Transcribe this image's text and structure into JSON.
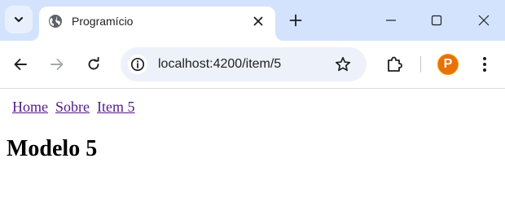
{
  "browser": {
    "tab": {
      "title": "Programício",
      "favicon": "globe-icon"
    },
    "address_bar": {
      "url": "localhost:4200/item/5"
    },
    "profile": {
      "initial": "P",
      "color": "#e8710a"
    },
    "colors": {
      "tabstrip": "#d3e3fd",
      "omnibox": "#edf2fa"
    }
  },
  "page": {
    "nav": {
      "links": [
        {
          "label": "Home"
        },
        {
          "label": "Sobre"
        },
        {
          "label": "Item 5"
        }
      ],
      "link_color": "#551a8b"
    },
    "title": "Modelo 5"
  }
}
